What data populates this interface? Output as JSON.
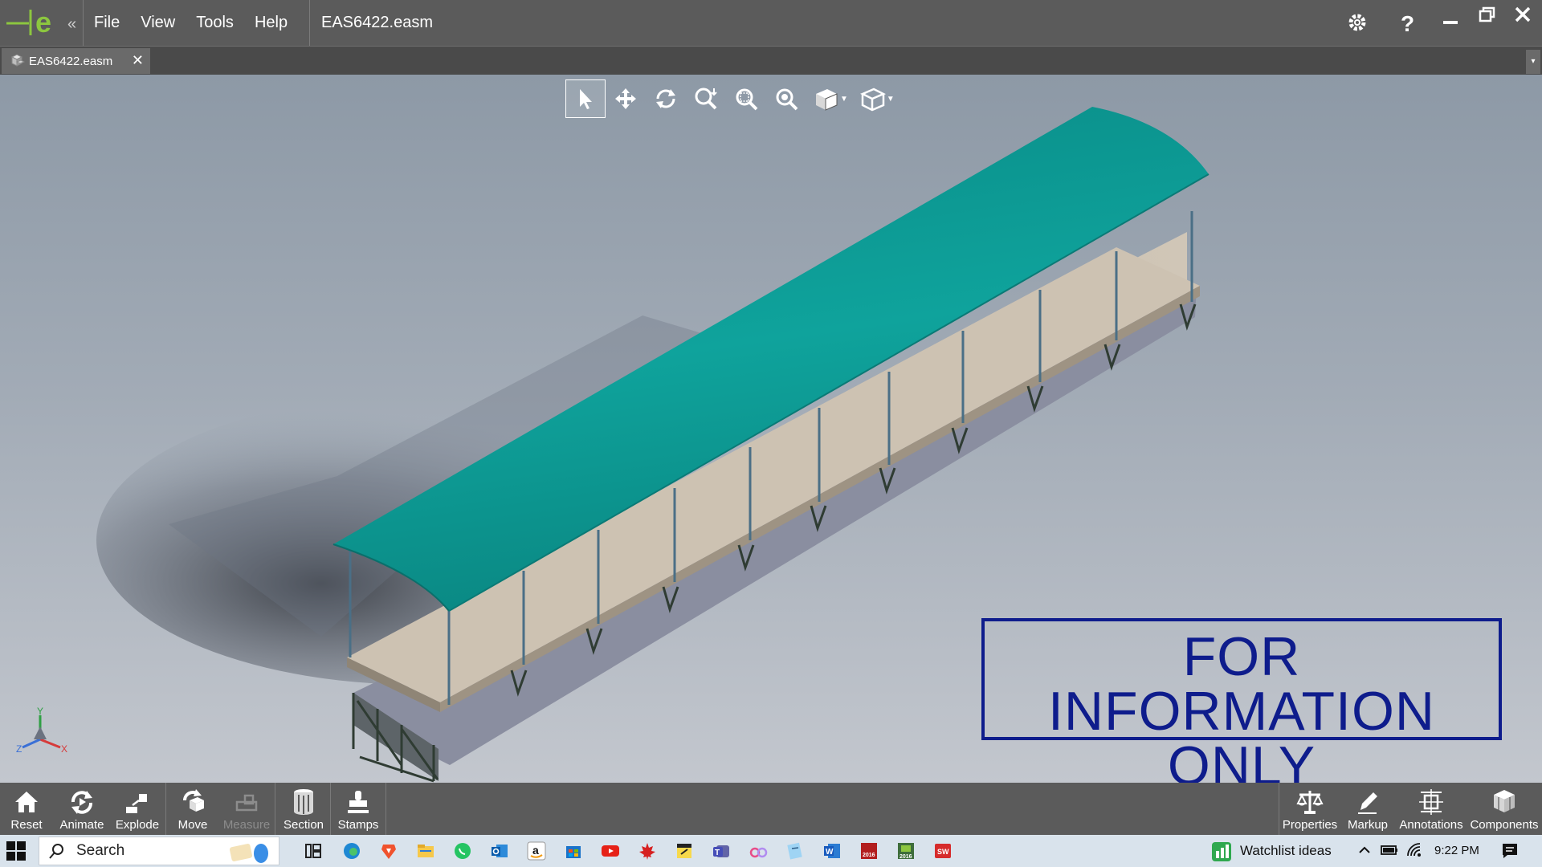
{
  "window": {
    "title": "EAS6422.easm",
    "menu": [
      "File",
      "View",
      "Tools",
      "Help"
    ],
    "collapse_glyph": "«"
  },
  "tabs": [
    {
      "label": "EAS6422.easm",
      "close_glyph": "✕"
    }
  ],
  "tab_dropdown_glyph": "▾",
  "viewport": {
    "stamp_line1": "FOR INFORMATION",
    "stamp_line2": "ONLY",
    "triad": {
      "x": "X",
      "y": "Y",
      "z": "Z"
    },
    "view_tools": [
      "select-icon",
      "pan-icon",
      "rotate-icon",
      "zoom-to-fit-icon",
      "zoom-to-area-icon",
      "zoom-icon",
      "view-orientation-icon",
      "display-style-icon"
    ]
  },
  "bottom_toolbar": {
    "left": [
      {
        "label": "Reset",
        "icon": "home-icon",
        "enabled": true
      },
      {
        "label": "Animate",
        "icon": "animate-icon",
        "enabled": true
      },
      {
        "label": "Explode",
        "icon": "explode-icon",
        "enabled": true
      },
      {
        "label": "Move",
        "icon": "move-icon",
        "enabled": true
      },
      {
        "label": "Measure",
        "icon": "measure-icon",
        "enabled": false
      },
      {
        "label": "Section",
        "icon": "section-icon",
        "enabled": true
      },
      {
        "label": "Stamps",
        "icon": "stamp-icon",
        "enabled": true
      }
    ],
    "right": [
      {
        "label": "Properties",
        "icon": "scales-icon"
      },
      {
        "label": "Markup",
        "icon": "pencil-icon"
      },
      {
        "label": "Annotations",
        "icon": "annotation-icon"
      },
      {
        "label": "Components",
        "icon": "cube-icon"
      }
    ]
  },
  "taskbar": {
    "search_label": "Search",
    "widget_label": "Watchlist ideas",
    "clock": "9:22 PM"
  },
  "colors": {
    "roof": "#0e9b95",
    "deck": "#c9beae",
    "stamp": "#0e1c8c",
    "chrome": "#5b5b5b",
    "accent": "#8cc63f"
  }
}
